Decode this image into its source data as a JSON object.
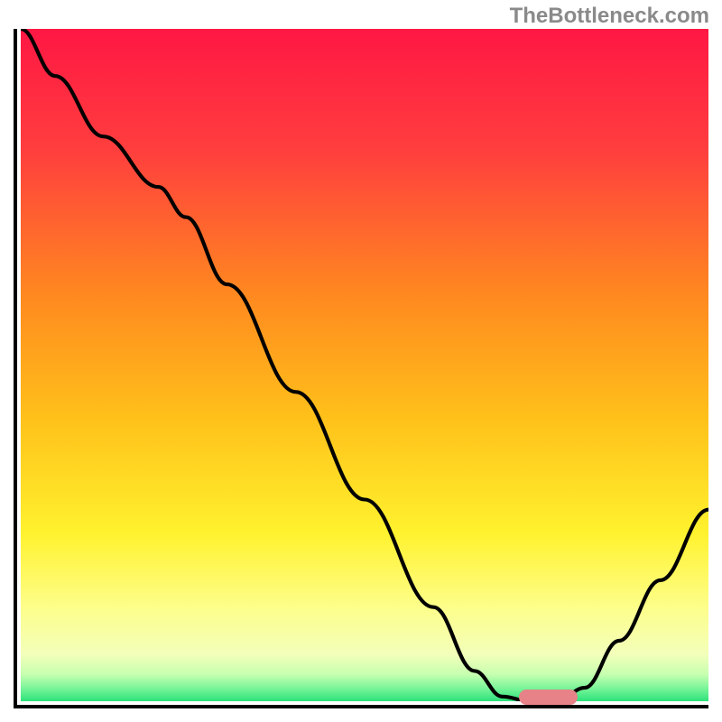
{
  "watermark": "TheBottleneck.com",
  "chart_data": {
    "type": "line",
    "title": "",
    "xlabel": "",
    "ylabel": "",
    "x_range": [
      0,
      100
    ],
    "y_range": [
      0,
      100
    ],
    "gradient_stops": [
      {
        "offset": 0,
        "color": "#ff1744"
      },
      {
        "offset": 18,
        "color": "#ff3e3e"
      },
      {
        "offset": 40,
        "color": "#ff8a1f"
      },
      {
        "offset": 58,
        "color": "#ffc11a"
      },
      {
        "offset": 75,
        "color": "#fff22e"
      },
      {
        "offset": 86,
        "color": "#fdfe8a"
      },
      {
        "offset": 93,
        "color": "#f3ffba"
      },
      {
        "offset": 96,
        "color": "#c7ffb0"
      },
      {
        "offset": 98,
        "color": "#7cf59a"
      },
      {
        "offset": 100,
        "color": "#2de27b"
      }
    ],
    "series": [
      {
        "name": "bottleneck-curve",
        "points": [
          {
            "x": 0.0,
            "y": 100.0
          },
          {
            "x": 5.0,
            "y": 93.0
          },
          {
            "x": 12.0,
            "y": 84.0
          },
          {
            "x": 20.0,
            "y": 76.5
          },
          {
            "x": 24.0,
            "y": 72.0
          },
          {
            "x": 30.0,
            "y": 62.0
          },
          {
            "x": 40.0,
            "y": 46.0
          },
          {
            "x": 50.0,
            "y": 30.0
          },
          {
            "x": 60.0,
            "y": 14.0
          },
          {
            "x": 66.0,
            "y": 4.5
          },
          {
            "x": 70.0,
            "y": 0.7
          },
          {
            "x": 74.0,
            "y": 0.0
          },
          {
            "x": 78.0,
            "y": 0.0
          },
          {
            "x": 82.0,
            "y": 2.0
          },
          {
            "x": 87.0,
            "y": 9.0
          },
          {
            "x": 93.0,
            "y": 18.0
          },
          {
            "x": 100.0,
            "y": 28.5
          }
        ]
      }
    ],
    "marker": {
      "x_start": 72,
      "x_end": 80.5,
      "y": 0.3
    }
  }
}
